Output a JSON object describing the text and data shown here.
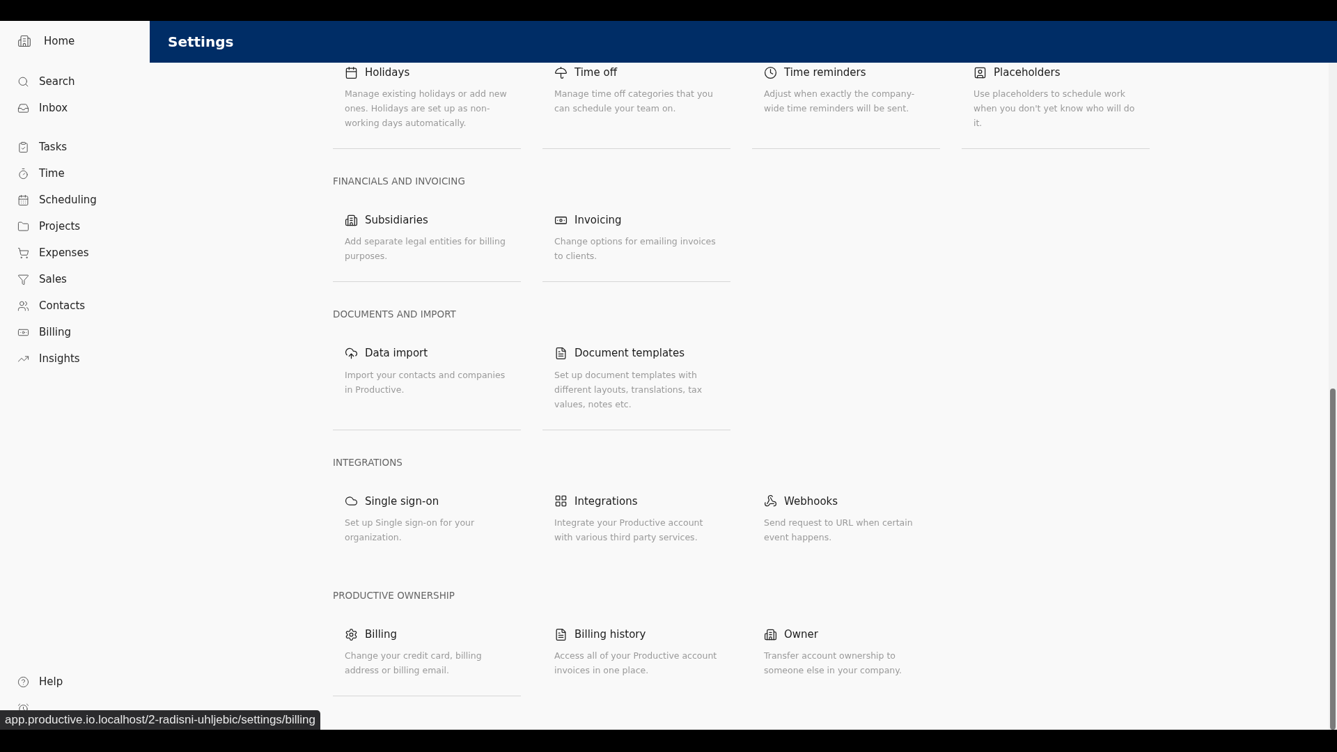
{
  "header": {
    "title": "Settings"
  },
  "sidebar": {
    "home": "Home",
    "groups": [
      [
        "Search",
        "Inbox"
      ],
      [
        "Tasks",
        "Time",
        "Scheduling",
        "Projects",
        "Expenses",
        "Sales",
        "Contacts",
        "Billing",
        "Insights"
      ]
    ],
    "bottom": [
      "Help"
    ]
  },
  "sections": [
    {
      "cards": [
        {
          "title": "Holidays",
          "description": "Manage existing holidays or add new ones. Holidays are set up as non-working days automatically.",
          "underlined": true
        },
        {
          "title": "Time off",
          "description": "Manage time off categories that you can schedule your team on.",
          "underlined": true
        },
        {
          "title": "Time reminders",
          "description": "Adjust when exactly the company-wide time reminders will be sent.",
          "underlined": true
        },
        {
          "title": "Placeholders",
          "description": "Use placeholders to schedule work when you don't yet know who will do it.",
          "underlined": true
        }
      ]
    },
    {
      "heading": "FINANCIALS AND INVOICING",
      "cards": [
        {
          "title": "Subsidiaries",
          "description": "Add separate legal entities for billing purposes.",
          "underlined": true
        },
        {
          "title": "Invoicing",
          "description": "Change options for emailing invoices to clients.",
          "underlined": true
        }
      ]
    },
    {
      "heading": "DOCUMENTS AND IMPORT",
      "cards": [
        {
          "title": "Data import",
          "description": "Import your contacts and companies in Productive.",
          "underlined": true
        },
        {
          "title": "Document templates",
          "description": "Set up document templates with different layouts, translations, tax values, notes etc.",
          "underlined": true
        }
      ]
    },
    {
      "heading": "INTEGRATIONS",
      "cards": [
        {
          "title": "Single sign-on",
          "description": "Set up Single sign-on for your organization.",
          "underlined": false
        },
        {
          "title": "Integrations",
          "description": "Integrate your Productive account with various third party services.",
          "underlined": false
        },
        {
          "title": "Webhooks",
          "description": "Send request to URL when certain event happens.",
          "underlined": false
        }
      ]
    },
    {
      "heading": "PRODUCTIVE OWNERSHIP",
      "cards": [
        {
          "title": "Billing",
          "description": "Change your credit card, billing address or billing email.",
          "underlined": true
        },
        {
          "title": "Billing history",
          "description": "Access all of your Productive account invoices in one place.",
          "underlined": false
        },
        {
          "title": "Owner",
          "description": "Transfer account ownership to someone else in your company.",
          "underlined": false
        }
      ]
    }
  ],
  "link_preview": {
    "url": "app.productive.io.localhost/2-radisni-uhljebic/settings/billing"
  }
}
